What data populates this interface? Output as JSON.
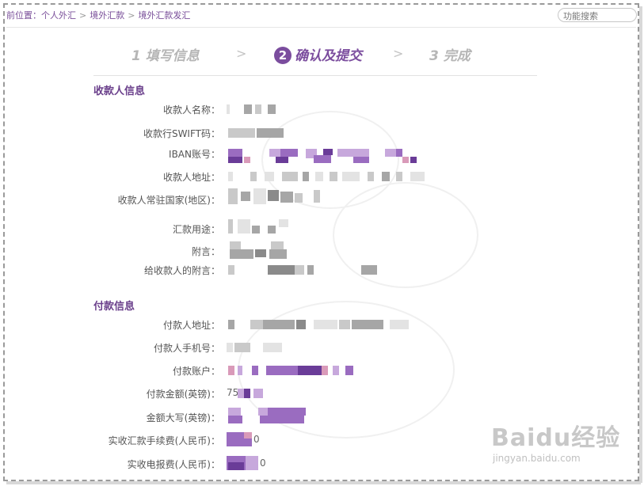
{
  "breadcrumb": {
    "prefix": "前位置：",
    "items": [
      "个人外汇",
      "境外汇款",
      "境外汇款发汇"
    ],
    "sep": ">"
  },
  "search": {
    "placeholder": "功能搜索"
  },
  "steps": [
    {
      "num": "1",
      "label": "填写信息",
      "active": false
    },
    {
      "num": "2",
      "label": "确认及提交",
      "active": true
    },
    {
      "num": "3",
      "label": "完成",
      "active": false
    }
  ],
  "step_chevron": ">",
  "payee": {
    "title": "收款人信息",
    "fields": [
      {
        "label": "收款人名称："
      },
      {
        "label": "收款行SWIFT码："
      },
      {
        "label": "IBAN账号："
      },
      {
        "label": "收款人地址："
      },
      {
        "label": "收款人常驻国家(地区)："
      },
      {
        "label": "汇款用途："
      },
      {
        "label": "附言："
      },
      {
        "label": "给收款人的附言："
      }
    ]
  },
  "payer": {
    "title": "付款信息",
    "fields": [
      {
        "label": "付款人地址："
      },
      {
        "label": "付款人手机号："
      },
      {
        "label": "付款账户："
      },
      {
        "label": "付款金额(英镑)：",
        "value": "75"
      },
      {
        "label": "金额大写(英镑)："
      },
      {
        "label": "实收汇款手续费(人民币)：",
        "value": "0"
      },
      {
        "label": "实收电报费(人民币)：",
        "value": "0"
      }
    ]
  },
  "watermark": {
    "brand": "Baidu经验",
    "url": "jingyan.baidu.com"
  },
  "colors": {
    "accent": "#7b4d9e",
    "section_title": "#6a3f8b",
    "inactive_step": "#b6b6b6"
  }
}
